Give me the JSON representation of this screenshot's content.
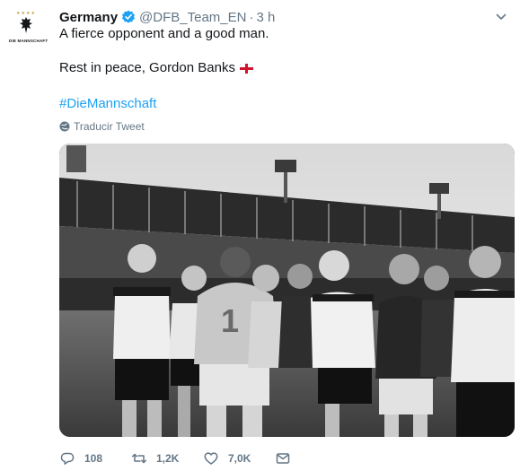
{
  "account": {
    "avatar_wordmark": "DIE MANNSCHAFT",
    "display_name": "Germany",
    "verified_icon": "verified-badge-icon",
    "handle": "@DFB_Team_EN",
    "separator": "·",
    "time": "3 h"
  },
  "tweet": {
    "line1": "A fierce opponent and a good man.",
    "line2": "Rest in peace, Gordon Banks",
    "flag_icon": "england-flag-icon",
    "hashtag": "#DieMannschaft",
    "translate_label": "Traducir Tweet"
  },
  "actions": {
    "reply_count": "108",
    "retweet_count": "1,2K",
    "like_count": "7,0K"
  },
  "colors": {
    "link": "#1da1f2",
    "secondary": "#657786",
    "text": "#14171a",
    "verified": "#1da1f2",
    "flag_red": "#cf142b"
  }
}
